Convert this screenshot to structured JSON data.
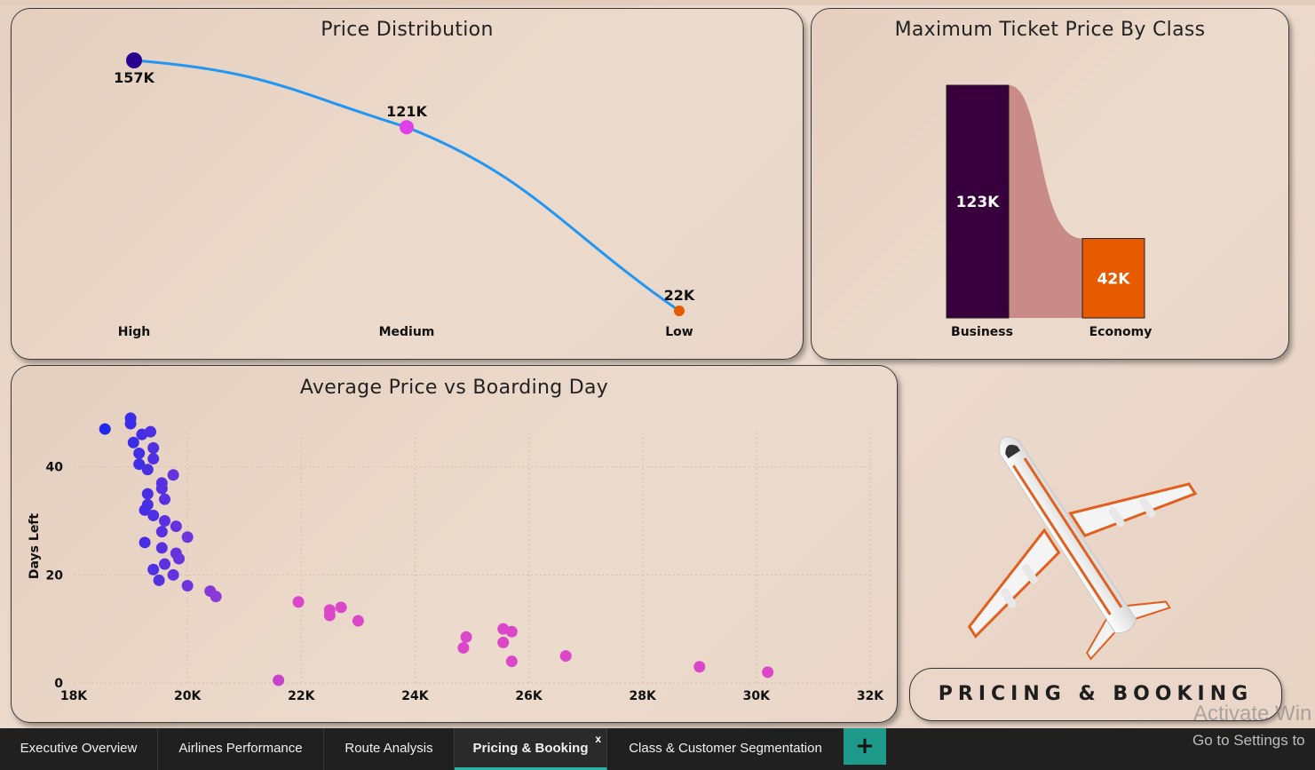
{
  "banner": "PRICING & BOOKING",
  "watermark": {
    "line1": "Activate Win",
    "line2": "Go to Settings to"
  },
  "tabs": [
    {
      "label": "Executive Overview"
    },
    {
      "label": "Airlines Performance"
    },
    {
      "label": "Route Analysis"
    },
    {
      "label": "Pricing & Booking",
      "active": true,
      "close": "x"
    },
    {
      "label": "Class & Customer Segmentation"
    }
  ],
  "add_tab_label": "+",
  "colors": {
    "line": "#2196f3",
    "business": "#37003c",
    "economy": "#e85a00",
    "ribbon": "#c98b88"
  },
  "chart_data": [
    {
      "type": "line",
      "title": "Price Distribution",
      "categories": [
        "High",
        "Medium",
        "Low"
      ],
      "values": [
        157000,
        121000,
        22000
      ],
      "data_labels": [
        "157K",
        "121K",
        "22K"
      ],
      "point_colors": [
        "#2a0090",
        "#e040e8",
        "#e85a00"
      ]
    },
    {
      "type": "bar",
      "title": "Maximum Ticket Price By Class",
      "categories": [
        "Business",
        "Economy"
      ],
      "values": [
        123000,
        42000
      ],
      "data_labels": [
        "123K",
        "42K"
      ]
    },
    {
      "type": "scatter",
      "title": "Average Price vs Boarding Day",
      "xlabel": "",
      "ylabel": "Days Left",
      "xlim": [
        18000,
        32000
      ],
      "ylim": [
        0,
        48
      ],
      "xticks": [
        "18K",
        "20K",
        "22K",
        "24K",
        "26K",
        "28K",
        "30K",
        "32K"
      ],
      "xtick_values": [
        18000,
        20000,
        22000,
        24000,
        26000,
        28000,
        30000,
        32000
      ],
      "yticks": [
        "0",
        "20",
        "40"
      ],
      "ytick_values": [
        0,
        20,
        40
      ],
      "points": [
        [
          18550,
          47
        ],
        [
          19000,
          49
        ],
        [
          19000,
          48
        ],
        [
          19200,
          46
        ],
        [
          19350,
          46.5
        ],
        [
          19050,
          44.5
        ],
        [
          19400,
          43.5
        ],
        [
          19150,
          42.5
        ],
        [
          19400,
          41.5
        ],
        [
          19150,
          40.5
        ],
        [
          19300,
          39.5
        ],
        [
          19750,
          38.5
        ],
        [
          19550,
          37
        ],
        [
          19550,
          36
        ],
        [
          19300,
          35
        ],
        [
          19600,
          34
        ],
        [
          19300,
          33
        ],
        [
          19250,
          32
        ],
        [
          19400,
          31
        ],
        [
          19600,
          30
        ],
        [
          19800,
          29
        ],
        [
          19550,
          28
        ],
        [
          20000,
          27
        ],
        [
          19250,
          26
        ],
        [
          19550,
          25
        ],
        [
          19800,
          24
        ],
        [
          19850,
          23
        ],
        [
          19600,
          22
        ],
        [
          19400,
          21
        ],
        [
          19750,
          20
        ],
        [
          19500,
          19
        ],
        [
          20000,
          18
        ],
        [
          20400,
          17
        ],
        [
          20500,
          16
        ],
        [
          21950,
          15
        ],
        [
          22500,
          13.5
        ],
        [
          22700,
          14
        ],
        [
          22500,
          12.5
        ],
        [
          23000,
          11.5
        ],
        [
          25550,
          10
        ],
        [
          24900,
          8.5
        ],
        [
          25700,
          9.5
        ],
        [
          25550,
          7.5
        ],
        [
          24850,
          6.5
        ],
        [
          26650,
          5
        ],
        [
          25700,
          4
        ],
        [
          29000,
          3
        ],
        [
          30200,
          2
        ],
        [
          21600,
          0.5
        ]
      ]
    }
  ]
}
